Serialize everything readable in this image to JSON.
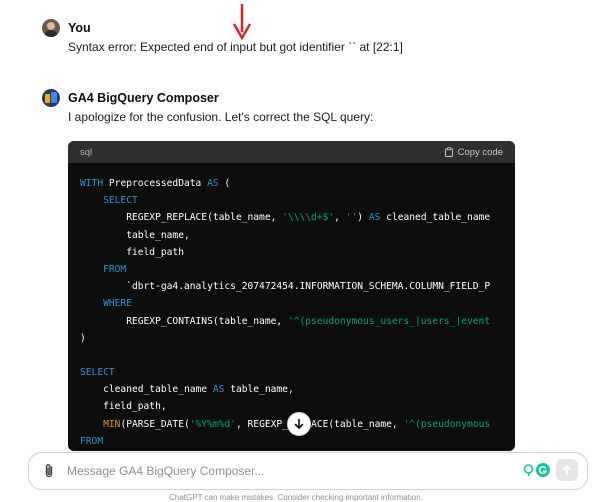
{
  "user_message": {
    "author": "You",
    "text": "Syntax error: Expected end of input but got identifier `` at [22:1]"
  },
  "bot_message": {
    "author": "GA4 BigQuery Composer",
    "text": "I apologize for the confusion. Let's correct the SQL query:"
  },
  "code_block": {
    "language": "sql",
    "copy_label": "Copy code",
    "lines": [
      [
        {
          "t": "WITH ",
          "c": "kw"
        },
        {
          "t": "PreprocessedData ",
          "c": ""
        },
        {
          "t": "AS",
          "c": "kw"
        },
        {
          "t": " (",
          "c": ""
        }
      ],
      [
        {
          "t": "    ",
          "c": ""
        },
        {
          "t": "SELECT",
          "c": "kw"
        }
      ],
      [
        {
          "t": "        REGEXP_REPLACE(table_name, ",
          "c": ""
        },
        {
          "t": "'\\\\\\\\d+$'",
          "c": "str"
        },
        {
          "t": ", ",
          "c": ""
        },
        {
          "t": "''",
          "c": "str"
        },
        {
          "t": ") ",
          "c": ""
        },
        {
          "t": "AS",
          "c": "kw"
        },
        {
          "t": " cleaned_table_name",
          "c": ""
        }
      ],
      [
        {
          "t": "        table_name,",
          "c": ""
        }
      ],
      [
        {
          "t": "        field_path",
          "c": ""
        }
      ],
      [
        {
          "t": "    ",
          "c": ""
        },
        {
          "t": "FROM",
          "c": "kw"
        }
      ],
      [
        {
          "t": "        `dbrt-ga4.analytics_207472454.INFORMATION_SCHEMA.COLUMN_FIELD_P",
          "c": ""
        }
      ],
      [
        {
          "t": "    ",
          "c": ""
        },
        {
          "t": "WHERE",
          "c": "kw"
        }
      ],
      [
        {
          "t": "        REGEXP_CONTAINS(table_name, ",
          "c": ""
        },
        {
          "t": "'^(pseudonymous_users_|users_|event",
          "c": "str"
        }
      ],
      [
        {
          "t": ")",
          "c": ""
        }
      ],
      [
        {
          "t": "",
          "c": ""
        }
      ],
      [
        {
          "t": "SELECT",
          "c": "kw"
        }
      ],
      [
        {
          "t": "    cleaned_table_name ",
          "c": ""
        },
        {
          "t": "AS",
          "c": "kw"
        },
        {
          "t": " table_name,",
          "c": ""
        }
      ],
      [
        {
          "t": "    field_path,",
          "c": ""
        }
      ],
      [
        {
          "t": "    ",
          "c": ""
        },
        {
          "t": "MIN",
          "c": "fn"
        },
        {
          "t": "(PARSE_DATE(",
          "c": ""
        },
        {
          "t": "'%Y%m%d'",
          "c": "str"
        },
        {
          "t": ", REGEXP_REPLACE(table_name, ",
          "c": ""
        },
        {
          "t": "'^(pseudonymous",
          "c": "str"
        }
      ],
      [
        {
          "t": "FROM",
          "c": "kw"
        }
      ]
    ]
  },
  "composer": {
    "placeholder": "Message GA4 BigQuery Composer..."
  },
  "footer": {
    "text": "ChatGPT can make mistakes. Consider checking important information."
  },
  "colors": {
    "keyword": "#2e95d3",
    "string": "#00a67d",
    "function": "#e9950c",
    "annotation_arrow": "#e02020"
  },
  "icons": {
    "annotation": "red-down-arrow",
    "copy": "clipboard-icon",
    "scroll": "arrow-down-icon",
    "attach": "paperclip-icon",
    "send": "arrow-up-icon"
  }
}
